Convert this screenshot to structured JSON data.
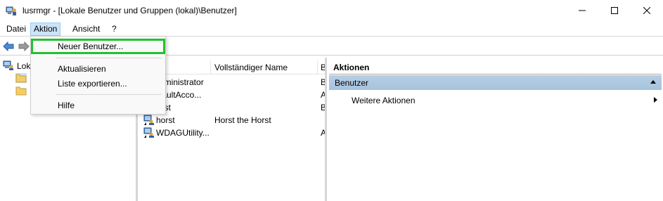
{
  "window": {
    "title": "lusrmgr - [Lokale Benutzer und Gruppen (lokal)\\Benutzer]"
  },
  "menubar": {
    "items": [
      "Datei",
      "Aktion",
      "Ansicht",
      "?"
    ]
  },
  "dropdown": {
    "items": [
      "Neuer Benutzer...",
      "Aktualisieren",
      "Liste exportieren...",
      "Hilfe"
    ]
  },
  "tree": {
    "root_label": "Lok"
  },
  "list": {
    "columns": [
      "e",
      "Vollständiger Name",
      "B"
    ],
    "rows": [
      {
        "name": "dministrator",
        "full_name": "",
        "desc": "B"
      },
      {
        "name": "faultAcco...",
        "full_name": "",
        "desc": "A"
      },
      {
        "name": "est",
        "full_name": "",
        "desc": "B"
      },
      {
        "name": "horst",
        "full_name": "Horst the Horst",
        "desc": ""
      },
      {
        "name": "WDAGUtility...",
        "full_name": "",
        "desc": "A"
      }
    ]
  },
  "actions": {
    "header": "Aktionen",
    "section": "Benutzer",
    "item": "Weitere Aktionen"
  },
  "colors": {
    "selection": "#cce4f7",
    "highlight_outline": "#22c22e",
    "section_bg": "#b0c9e1"
  }
}
